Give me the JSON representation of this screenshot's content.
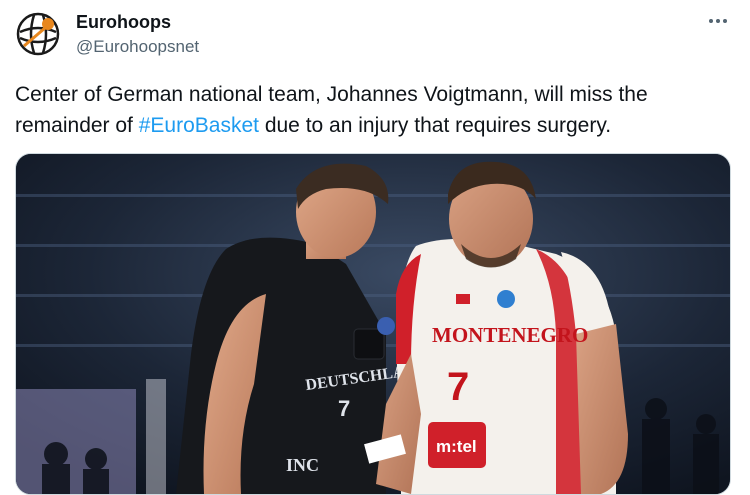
{
  "account": {
    "display_name": "Eurohoops",
    "handle": "@Eurohoopsnet",
    "avatar_icon": "eurohoops-logo-icon"
  },
  "tweet": {
    "text_before": "Center of German national team, Johannes Voigtmann, will miss the remainder of ",
    "hashtag": "#EuroBasket",
    "text_after": " due to an injury that requires surgery."
  },
  "menu": {
    "icon": "more-horizontal-icon"
  },
  "photo": {
    "left_jersey_text": "DEUTSCHLAND",
    "left_jersey_number": "7",
    "left_shorts_text": "INC",
    "right_jersey_text": "MONTENEGRO",
    "right_jersey_number": "7",
    "sponsor_logo": "m:tel"
  },
  "colors": {
    "hashtag": "#1d9bf0",
    "handle": "#536471",
    "montenegro_red": "#d0202a",
    "germany_black": "#16181c"
  }
}
